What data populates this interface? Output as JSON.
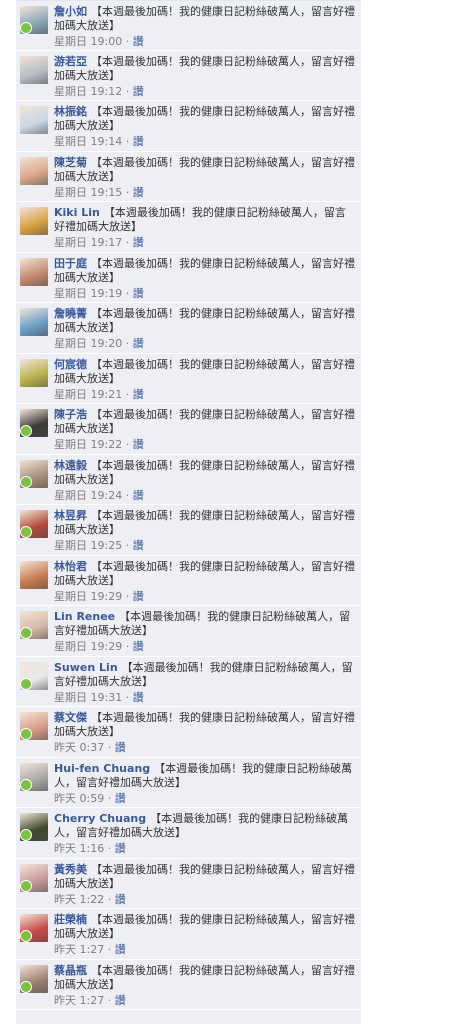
{
  "comments": [
    {
      "author": "詹小如",
      "message": "【本週最後加碼！我的健康日記粉絲破萬人，留言好禮加碼大放送】",
      "time": "星期日 19:00",
      "like": "讚",
      "avatar": "#8aa6b8",
      "dot": true
    },
    {
      "author": "游若亞",
      "message": "【本週最後加碼！我的健康日記粉絲破萬人，留言好禮加碼大放送】",
      "time": "星期日 19:12",
      "like": "讚",
      "avatar": "#b8bcc4",
      "dot": false
    },
    {
      "author": "林振銘",
      "message": "【本週最後加碼！我的健康日記粉絲破萬人，留言好禮加碼大放送】",
      "time": "星期日 19:14",
      "like": "讚",
      "avatar": "#c9d6e3",
      "dot": false
    },
    {
      "author": "陳芝菊",
      "message": "【本週最後加碼！我的健康日記粉絲破萬人，留言好禮加碼大放送】",
      "time": "星期日 19:15",
      "like": "讚",
      "avatar": "#d9a78c",
      "dot": false
    },
    {
      "author": "Kiki Lin",
      "message": "【本週最後加碼！我的健康日記粉絲破萬人，留言好禮加碼大放送】",
      "time": "星期日 19:17",
      "like": "讚",
      "avatar": "#d8a040",
      "dot": false
    },
    {
      "author": "田于庭",
      "message": "【本週最後加碼！我的健康日記粉絲破萬人，留言好禮加碼大放送】",
      "time": "星期日 19:19",
      "like": "讚",
      "avatar": "#c28a6e",
      "dot": false
    },
    {
      "author": "詹曉菁",
      "message": "【本週最後加碼！我的健康日記粉絲破萬人，留言好禮加碼大放送】",
      "time": "星期日 19:20",
      "like": "讚",
      "avatar": "#6b9ec8",
      "dot": false
    },
    {
      "author": "何宸德",
      "message": "【本週最後加碼！我的健康日記粉絲破萬人，留言好禮加碼大放送】",
      "time": "星期日 19:21",
      "like": "讚",
      "avatar": "#b8b34a",
      "dot": false
    },
    {
      "author": "陳子浩",
      "message": "【本週最後加碼！我的健康日記粉絲破萬人，留言好禮加碼大放送】",
      "time": "星期日 19:22",
      "like": "讚",
      "avatar": "#3a3a3a",
      "dot": true
    },
    {
      "author": "林遠毅",
      "message": "【本週最後加碼！我的健康日記粉絲破萬人，留言好禮加碼大放送】",
      "time": "星期日 19:24",
      "like": "讚",
      "avatar": "#a88f7a",
      "dot": true
    },
    {
      "author": "林昱昇",
      "message": "【本週最後加碼！我的健康日記粉絲破萬人，留言好禮加碼大放送】",
      "time": "星期日 19:25",
      "like": "讚",
      "avatar": "#b24a3a",
      "dot": true
    },
    {
      "author": "林怡君",
      "message": "【本週最後加碼！我的健康日記粉絲破萬人，留言好禮加碼大放送】",
      "time": "星期日 19:29",
      "like": "讚",
      "avatar": "#c87a50",
      "dot": false
    },
    {
      "author": "Lin Renee",
      "message": "【本週最後加碼！我的健康日記粉絲破萬人，留言好禮加碼大放送】",
      "time": "星期日 19:29",
      "like": "讚",
      "avatar": "#d8b8a8",
      "dot": true
    },
    {
      "author": "Suwen Lin",
      "message": "【本週最後加碼！我的健康日記粉絲破萬人，留言好禮加碼大放送】",
      "time": "星期日 19:31",
      "like": "讚",
      "avatar": "#e8e8ec",
      "dot": true
    },
    {
      "author": "蔡文傑",
      "message": "【本週最後加碼！我的健康日記粉絲破萬人，留言好禮加碼大放送】",
      "time": "昨天 0:37",
      "like": "讚",
      "avatar": "#d89c88",
      "dot": true
    },
    {
      "author": "Hui-fen Chuang",
      "message": "【本週最後加碼！我的健康日記粉絲破萬人，留言好禮加碼大放送】",
      "time": "昨天 0:59",
      "like": "讚",
      "avatar": "#a8a8a8",
      "dot": true
    },
    {
      "author": "Cherry Chuang",
      "message": "【本週最後加碼！我的健康日記粉絲破萬人，留言好禮加碼大放送】",
      "time": "昨天 1:16",
      "like": "讚",
      "avatar": "#3f4a2c",
      "dot": true
    },
    {
      "author": "黃秀美",
      "message": "【本週最後加碼！我的健康日記粉絲破萬人，留言好禮加碼大放送】",
      "time": "昨天 1:22",
      "like": "讚",
      "avatar": "#c89a9a",
      "dot": true
    },
    {
      "author": "莊榮楠",
      "message": "【本週最後加碼！我的健康日記粉絲破萬人，留言好禮加碼大放送】",
      "time": "昨天 1:27",
      "like": "讚",
      "avatar": "#c84848",
      "dot": true
    },
    {
      "author": "蔡晶瓶",
      "message": "【本週最後加碼！我的健康日記粉絲破萬人，留言好禮加碼大放送】",
      "time": "昨天 1:27",
      "like": "讚",
      "avatar": "#9a8070",
      "dot": true
    }
  ]
}
